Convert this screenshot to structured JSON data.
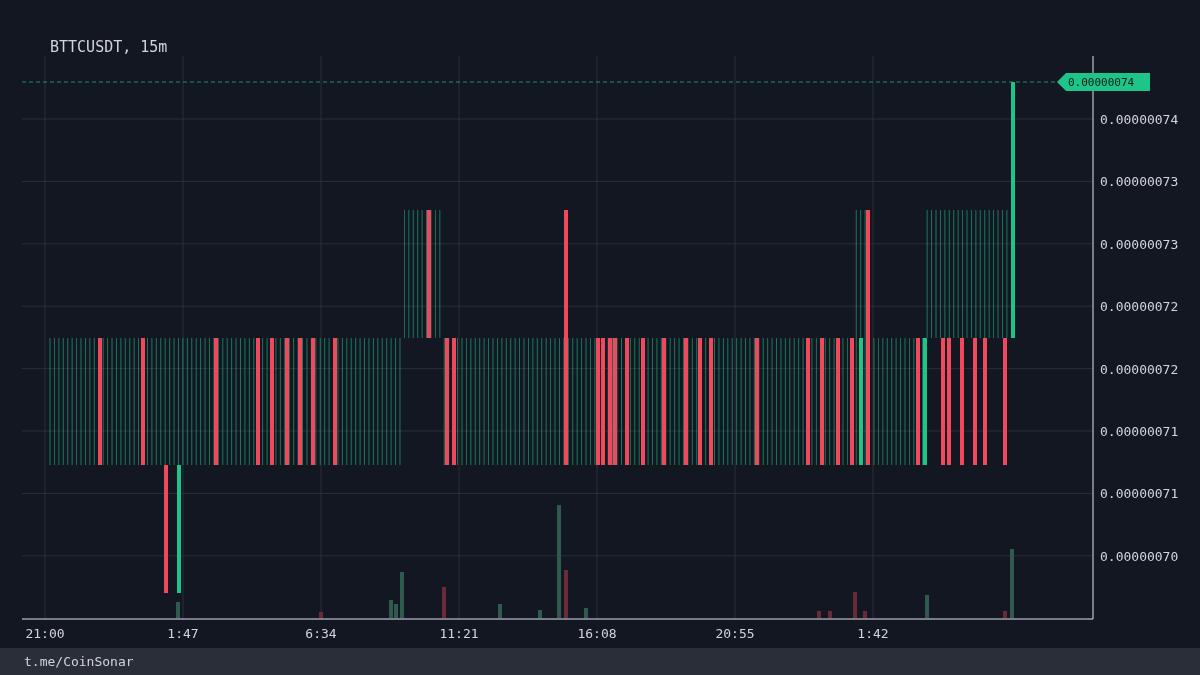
{
  "chart": {
    "title": "BTTCUSDT, 15m",
    "price_tag": "0.00000074",
    "y_axis_labels": [
      "0.00000074",
      "0.00000073",
      "0.00000073",
      "0.00000072",
      "0.00000072",
      "0.00000071",
      "0.00000071",
      "0.00000070"
    ],
    "x_axis_labels": [
      "21:00",
      "1:47",
      "6:34",
      "11:21",
      "16:08",
      "20:55",
      "1:42"
    ]
  },
  "footer": {
    "text": "t.me/CoinSonar"
  }
}
